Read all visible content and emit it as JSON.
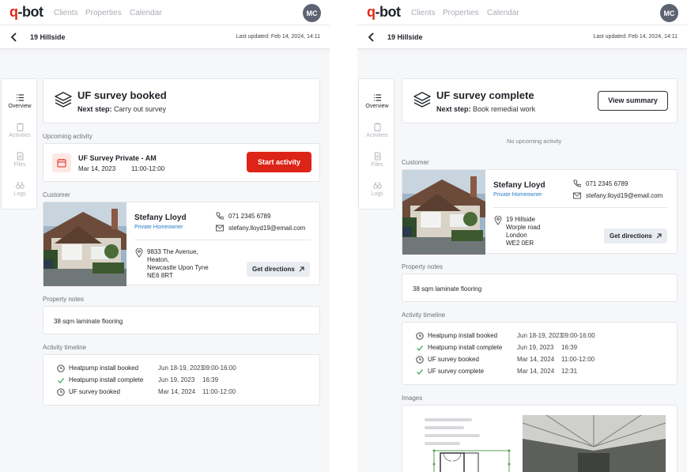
{
  "brand": {
    "logo": "q-bot",
    "accent": "#dd2418"
  },
  "nav": {
    "clients": "Clients",
    "properties": "Properties",
    "calendar": "Calendar"
  },
  "user": {
    "initials": "MC"
  },
  "header": {
    "title": "19 Hillside",
    "last_updated": "Last updated: Feb 14, 2024, 14:11"
  },
  "sidebar": {
    "items": [
      {
        "label": "Overview",
        "icon": "list-icon",
        "active": true
      },
      {
        "label": "Activities",
        "icon": "clipboard-icon"
      },
      {
        "label": "Files",
        "icon": "file-icon"
      },
      {
        "label": "Logs",
        "icon": "binoculars-icon"
      }
    ]
  },
  "left": {
    "status": {
      "title": "UF survey booked",
      "next_label": "Next step:",
      "next_value": "Carry out survey"
    },
    "upcoming": {
      "label": "Upcoming activity",
      "title": "UF Survey Private - AM",
      "date": "Mar 14, 2023",
      "time": "11:00-12:00",
      "button": "Start activity"
    },
    "customer": {
      "label": "Customer",
      "name": "Stefany Lloyd",
      "type": "Private Homeowner",
      "phone": "071 2345 6789",
      "email": "stefany.lloyd19@email.com",
      "address": [
        "9833 The Avenue,",
        "Heaton,",
        "Newcastle Upon Tyne",
        "NE6 8RT"
      ],
      "directions": "Get directions"
    },
    "notes": {
      "label": "Property notes",
      "text": "38 sqm laminate flooring"
    },
    "timeline": {
      "label": "Activity timeline",
      "rows": [
        {
          "icon": "clock-icon",
          "name": "Heatpump install booked",
          "date": "Jun 18-19, 2023",
          "time": "09:00-16:00"
        },
        {
          "icon": "check-icon",
          "name": "Heatpump install complete",
          "date": "Jun 19, 2023",
          "time": "16:39"
        },
        {
          "icon": "clock-icon",
          "name": "UF survey booked",
          "date": "Mar 14, 2024",
          "time": "11:00-12:00"
        }
      ]
    }
  },
  "right": {
    "status": {
      "title": "UF survey complete",
      "next_label": "Next step:",
      "next_value": "Book remedial work",
      "button": "View summary"
    },
    "upcoming": {
      "empty": "No upcoming activity"
    },
    "customer": {
      "label": "Customer",
      "name": "Stefany Lloyd",
      "type": "Private Homeowner",
      "phone": "071 2345 6789",
      "email": "stefany.lloyd19@email.com",
      "address": [
        "19 Hillside",
        "Worple road",
        "London",
        "WE2 0ER"
      ],
      "directions": "Get directions"
    },
    "notes": {
      "label": "Property notes",
      "text": "38 sqm laminate flooring"
    },
    "timeline": {
      "label": "Activity timeline",
      "rows": [
        {
          "icon": "clock-icon",
          "name": "Heatpump install booked",
          "date": "Jun 18-19, 2023",
          "time": "09:00-16:00"
        },
        {
          "icon": "check-icon",
          "name": "Heatpump install complete",
          "date": "Jun 19, 2023",
          "time": "16:39"
        },
        {
          "icon": "clock-icon",
          "name": "UF survey booked",
          "date": "Mar 14, 2024",
          "time": "11:00-12:00"
        },
        {
          "icon": "check-icon",
          "name": "UF survey complete",
          "date": "Mar 14, 2024",
          "time": "12:31"
        }
      ]
    },
    "images": {
      "label": "Images"
    }
  }
}
